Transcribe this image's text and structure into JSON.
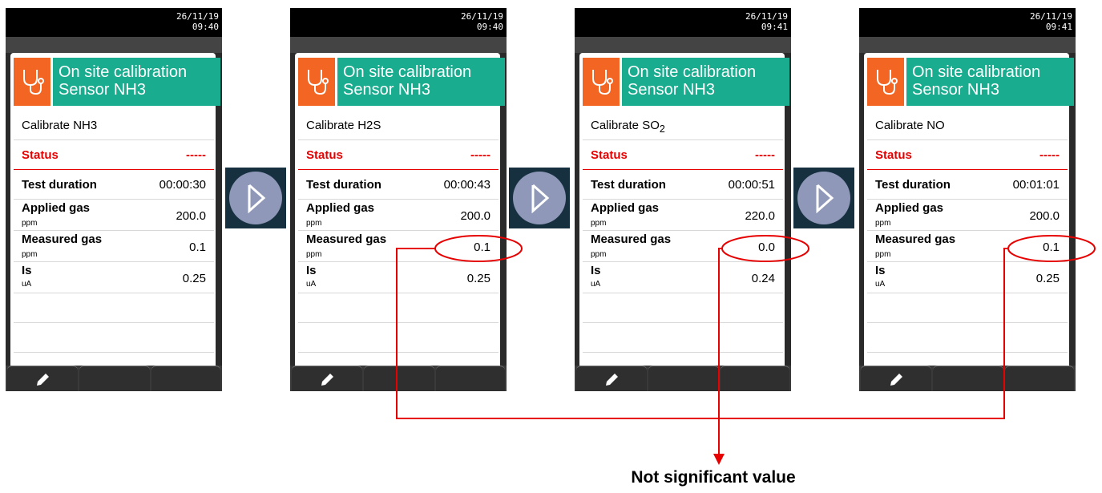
{
  "screens": [
    {
      "date": "26/11/19",
      "time": "09:40",
      "title_line1": "On site calibration",
      "title_line2": "Sensor NH3",
      "calibrate_label": "Calibrate NH3",
      "status_label": "Status",
      "status_value": "-----",
      "test_duration_label": "Test duration",
      "test_duration_value": "00:00:30",
      "applied_gas_label": "Applied gas",
      "applied_gas_unit": "ppm",
      "applied_gas_value": "200.0",
      "measured_gas_label": "Measured gas",
      "measured_gas_unit": "ppm",
      "measured_gas_value": "0.1",
      "is_label": "Is",
      "is_unit": "uA",
      "is_value": "0.25"
    },
    {
      "date": "26/11/19",
      "time": "09:40",
      "title_line1": "On site calibration",
      "title_line2": "Sensor NH3",
      "calibrate_label": "Calibrate H2S",
      "status_label": "Status",
      "status_value": "-----",
      "test_duration_label": "Test duration",
      "test_duration_value": "00:00:43",
      "applied_gas_label": "Applied gas",
      "applied_gas_unit": "ppm",
      "applied_gas_value": "200.0",
      "measured_gas_label": "Measured gas",
      "measured_gas_unit": "ppm",
      "measured_gas_value": "0.1",
      "is_label": "Is",
      "is_unit": "uA",
      "is_value": "0.25"
    },
    {
      "date": "26/11/19",
      "time": "09:41",
      "title_line1": "On site calibration",
      "title_line2": "Sensor NH3",
      "calibrate_label": "Calibrate SO",
      "calibrate_sub": "2",
      "status_label": "Status",
      "status_value": "-----",
      "test_duration_label": "Test duration",
      "test_duration_value": "00:00:51",
      "applied_gas_label": "Applied gas",
      "applied_gas_unit": "ppm",
      "applied_gas_value": "220.0",
      "measured_gas_label": "Measured gas",
      "measured_gas_unit": "ppm",
      "measured_gas_value": "0.0",
      "is_label": "Is",
      "is_unit": "uA",
      "is_value": "0.24"
    },
    {
      "date": "26/11/19",
      "time": "09:41",
      "title_line1": "On site calibration",
      "title_line2": "Sensor NH3",
      "calibrate_label": "Calibrate NO",
      "status_label": "Status",
      "status_value": "-----",
      "test_duration_label": "Test duration",
      "test_duration_value": "00:01:01",
      "applied_gas_label": "Applied gas",
      "applied_gas_unit": "ppm",
      "applied_gas_value": "200.0",
      "measured_gas_label": "Measured gas",
      "measured_gas_unit": "ppm",
      "measured_gas_value": "0.1",
      "is_label": "Is",
      "is_unit": "uA",
      "is_value": "0.25"
    }
  ],
  "annotation": {
    "caption": "Not significant value"
  },
  "colors": {
    "accent_teal": "#1aac8f",
    "accent_orange": "#f26522",
    "annotation_red": "#e60000",
    "arrow_circle": "#8f98b8"
  },
  "icons": {
    "header": "stethoscope-icon",
    "softkey": "pencil-icon",
    "next": "chevron-right-icon"
  }
}
